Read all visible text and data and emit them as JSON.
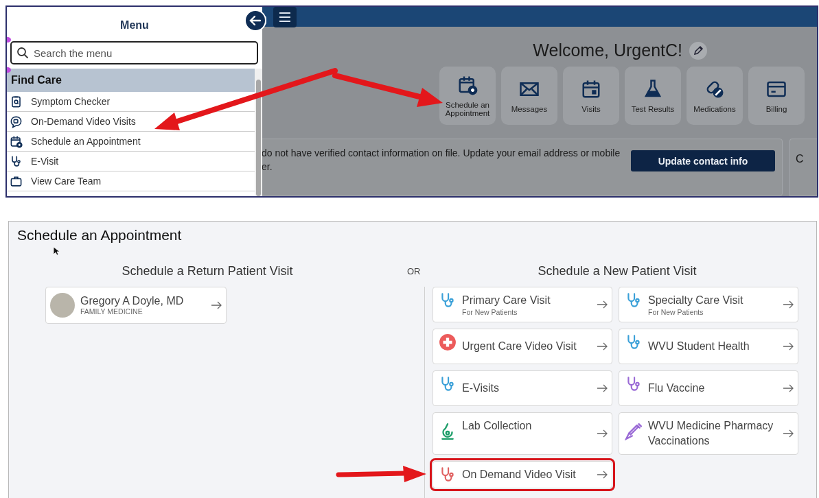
{
  "menu": {
    "title": "Menu",
    "search": {
      "placeholder": "Search the menu"
    },
    "section": "Find Care",
    "items": [
      {
        "label": "Symptom Checker",
        "kind": "clipboard"
      },
      {
        "label": "On-Demand Video Visits",
        "kind": "chat"
      },
      {
        "label": "Schedule an Appointment",
        "kind": "calendar-plus"
      },
      {
        "label": "E-Visit",
        "kind": "stethoscope"
      },
      {
        "label": "View Care Team",
        "kind": "team"
      }
    ]
  },
  "home": {
    "welcome": "Welcome, UrgentC!",
    "tiles": [
      {
        "label": "Schedule an Appointment",
        "kind": "calendar-plus"
      },
      {
        "label": "Messages",
        "kind": "envelope"
      },
      {
        "label": "Visits",
        "kind": "calendar"
      },
      {
        "label": "Test Results",
        "kind": "flask"
      },
      {
        "label": "Medications",
        "kind": "pills"
      },
      {
        "label": "Billing",
        "kind": "card"
      }
    ],
    "banner": {
      "line_1": "do not have verified contact information on file. Update your email address or mobile",
      "line_2": "er.",
      "button": "Update contact info"
    },
    "side_card": "C"
  },
  "schedule": {
    "title": "Schedule an Appointment",
    "return_heading": "Schedule a Return Patient Visit",
    "provider": {
      "name": "Gregory A Doyle, MD",
      "specialty": "FAMILY MEDICINE"
    },
    "or": "OR",
    "new_heading": "Schedule a New Patient Visit",
    "options": [
      {
        "title": "Primary Care Visit",
        "subtitle": "For New Patients",
        "kind": "stethoscope",
        "color": "#3aa0d8",
        "highlighted": false
      },
      {
        "title": "Specialty Care Visit",
        "subtitle": "For New Patients",
        "kind": "stethoscope",
        "color": "#3aa0d8",
        "highlighted": false
      },
      {
        "title": "Urgent Care Video Visit",
        "kind": "plus",
        "color": "#ec5b5b",
        "highlighted": false
      },
      {
        "title": "WVU Student Health",
        "kind": "stethoscope",
        "color": "#3aa0d8",
        "highlighted": false
      },
      {
        "title": "E-Visits",
        "kind": "stethoscope",
        "color": "#3aa0d8",
        "highlighted": false
      },
      {
        "title": "Flu Vaccine",
        "kind": "stethoscope",
        "color": "#9a6ad6",
        "highlighted": false
      },
      {
        "title": "Lab Collection",
        "kind": "microscope",
        "color": "#1e9e6a",
        "highlighted": false
      },
      {
        "title": "WVU Medicine Pharmacy Vaccinations",
        "kind": "syringe",
        "color": "#9a6ad6",
        "highlighted": false
      },
      {
        "title": "On Demand Video Visit",
        "kind": "stethoscope",
        "color": "#e06060",
        "highlighted": true
      }
    ]
  }
}
